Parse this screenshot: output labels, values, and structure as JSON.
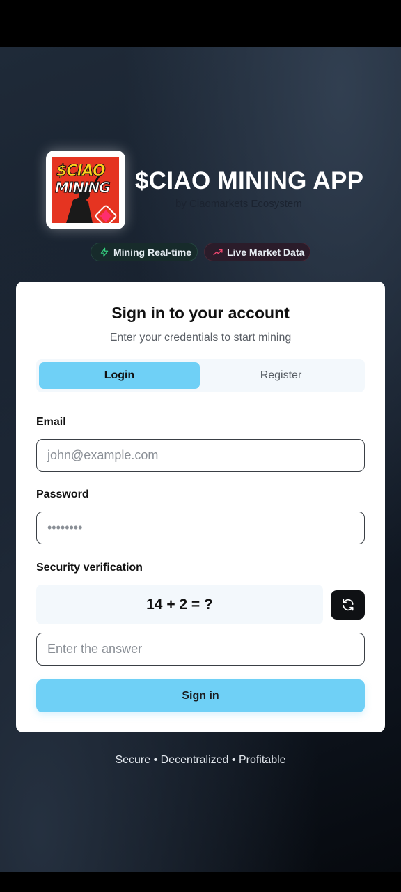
{
  "app": {
    "title": "$CIAO MINING APP",
    "subtitle": "by Ciaomarkets Ecosystem",
    "logo_line1": "$CIAO",
    "logo_line2": "MINING"
  },
  "badges": {
    "mining": {
      "label": "Mining Real-time",
      "icon": "lightning-icon",
      "color": "#35d07f"
    },
    "market": {
      "label": "Live Market Data",
      "icon": "trending-up-icon",
      "color": "#ef4870"
    }
  },
  "card": {
    "title": "Sign in to your account",
    "subtitle": "Enter your credentials to start mining"
  },
  "tabs": [
    {
      "label": "Login",
      "active": true
    },
    {
      "label": "Register",
      "active": false
    }
  ],
  "form": {
    "email_label": "Email",
    "email_placeholder": "john@example.com",
    "email_value": "",
    "password_label": "Password",
    "password_placeholder": "••••••••",
    "password_value": "",
    "security_label": "Security verification",
    "captcha_question": "14 + 2 = ?",
    "refresh_icon": "refresh-icon",
    "answer_placeholder": "Enter the answer",
    "answer_value": "",
    "submit_label": "Sign in"
  },
  "footer": {
    "tagline": "Secure • Decentralized • Profitable"
  },
  "colors": {
    "accent": "#6fd0f6",
    "background": "#151e2b",
    "card": "#ffffff"
  }
}
